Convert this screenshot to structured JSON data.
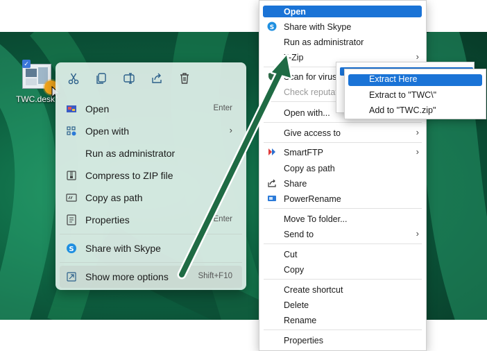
{
  "desktop": {
    "icon_label": "TWC.desk"
  },
  "w11_menu": {
    "toolbar": [
      {
        "name": "cut-icon"
      },
      {
        "name": "copy-icon"
      },
      {
        "name": "rename-icon"
      },
      {
        "name": "share-icon"
      },
      {
        "name": "delete-icon"
      }
    ],
    "items": [
      {
        "label": "Open",
        "shortcut": "Enter",
        "icon": "open-icon"
      },
      {
        "label": "Open with",
        "shortcut": "",
        "icon": "open-with-icon",
        "has_submenu": true
      },
      {
        "label": "Run as administrator",
        "shortcut": "",
        "icon": ""
      },
      {
        "label": "Compress to ZIP file",
        "shortcut": "",
        "icon": "zip-icon"
      },
      {
        "label": "Copy as path",
        "shortcut": "",
        "icon": "copy-path-icon"
      },
      {
        "label": "Properties",
        "shortcut": "t+Enter",
        "icon": "properties-icon"
      },
      {
        "label": "Share with Skype",
        "shortcut": "",
        "icon": "skype-icon"
      },
      {
        "label": "Show more options",
        "shortcut": "Shift+F10",
        "icon": "more-options-icon"
      }
    ]
  },
  "classic_menu": {
    "items": [
      {
        "label": "Open",
        "selected": true
      },
      {
        "label": "Share with Skype",
        "icon": "skype-icon"
      },
      {
        "label": "Run as administrator"
      },
      {
        "label": "7-Zip",
        "submenu": true
      },
      {
        "label": "Scan for viruse",
        "icon": "defender-icon"
      },
      {
        "label": "Check reputat",
        "dim": true,
        "icon": "defender-icon"
      },
      {
        "label": "Open with..."
      },
      {
        "label": "Give access to",
        "submenu": true
      },
      {
        "label": "SmartFTP",
        "submenu": true,
        "icon": "smartftp-icon"
      },
      {
        "label": "Copy as path"
      },
      {
        "label": "Share",
        "icon": "share-icon"
      },
      {
        "label": "PowerRename",
        "icon": "powerrename-icon"
      },
      {
        "label": "Move To folder..."
      },
      {
        "label": "Send to",
        "submenu": true
      },
      {
        "label": "Cut"
      },
      {
        "label": "Copy"
      },
      {
        "label": "Create shortcut"
      },
      {
        "label": "Delete"
      },
      {
        "label": "Rename"
      },
      {
        "label": "Properties"
      }
    ]
  },
  "zip_submenu": {
    "items": [
      {
        "label": "Extract Here",
        "selected": true
      },
      {
        "label": "Extract to \"TWC\\\""
      },
      {
        "label": "Add to \"TWC.zip\""
      }
    ]
  },
  "colors": {
    "accent": "#1a73d6",
    "arrow": "#1f6b44",
    "wallpaper": "#11704a"
  }
}
